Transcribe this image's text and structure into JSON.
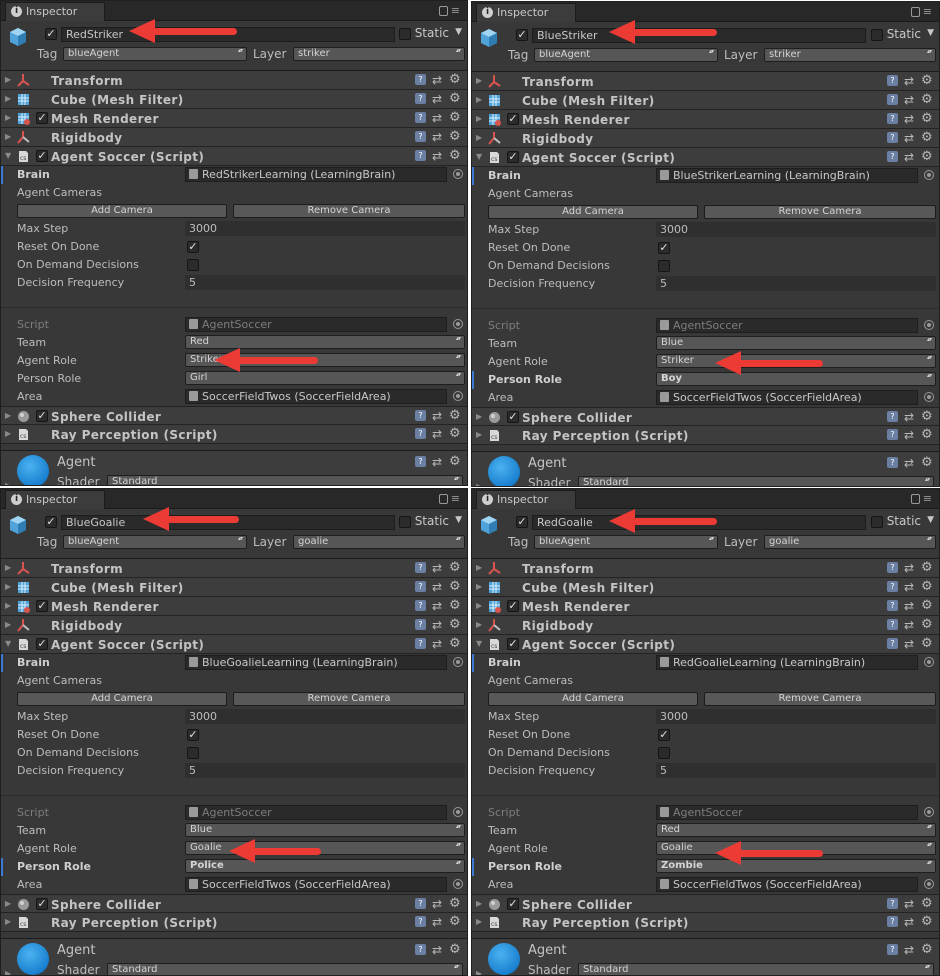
{
  "tab": {
    "label": "Inspector"
  },
  "header": {
    "tag_label": "Tag",
    "layer_label": "Layer",
    "static_label": "Static"
  },
  "components": {
    "transform": "Transform",
    "mesh_filter": "Cube (Mesh Filter)",
    "mesh_renderer": "Mesh Renderer",
    "rigidbody": "Rigidbody",
    "agent_soccer": "Agent Soccer (Script)",
    "sphere_collider": "Sphere Collider",
    "ray_perception": "Ray Perception (Script)"
  },
  "labels": {
    "brain": "Brain",
    "agent_cameras": "Agent Cameras",
    "add_camera": "Add Camera",
    "remove_camera": "Remove Camera",
    "max_step": "Max Step",
    "reset_on_done": "Reset On Done",
    "on_demand": "On Demand Decisions",
    "decision_frequency": "Decision Frequency",
    "script": "Script",
    "team": "Team",
    "agent_role": "Agent Role",
    "person_role": "Person Role",
    "area": "Area"
  },
  "material": {
    "name": "Agent",
    "shader_label": "Shader",
    "shader": "Standard"
  },
  "colors": {
    "arrow": "#ec3b35",
    "material_ball": "#1a80d0",
    "panel_bg": "#383838"
  },
  "panels": [
    {
      "name": "RedStriker",
      "tag": "blueAgent",
      "layer": "striker",
      "brain": "RedStrikerLearning (LearningBrain)",
      "max_step": "3000",
      "decision_frequency": "5",
      "script": "AgentSoccer",
      "team": "Red",
      "agent_role": "Striker",
      "person_role": "Girl",
      "area": "SoccerFieldTwos (SoccerFieldArea)"
    },
    {
      "name": "BlueStriker",
      "tag": "blueAgent",
      "layer": "striker",
      "brain": "BlueStrikerLearning (LearningBrain)",
      "max_step": "3000",
      "decision_frequency": "5",
      "script": "AgentSoccer",
      "team": "Blue",
      "agent_role": "Striker",
      "person_role": "Boy",
      "area": "SoccerFieldTwos (SoccerFieldArea)"
    },
    {
      "name": "BlueGoalie",
      "tag": "blueAgent",
      "layer": "goalie",
      "brain": "BlueGoalieLearning (LearningBrain)",
      "max_step": "3000",
      "decision_frequency": "5",
      "script": "AgentSoccer",
      "team": "Blue",
      "agent_role": "Goalie",
      "person_role": "Police",
      "area": "SoccerFieldTwos (SoccerFieldArea)"
    },
    {
      "name": "RedGoalie",
      "tag": "blueAgent",
      "layer": "goalie",
      "brain": "RedGoalieLearning (LearningBrain)",
      "max_step": "3000",
      "decision_frequency": "5",
      "script": "AgentSoccer",
      "team": "Red",
      "agent_role": "Goalie",
      "person_role": "Zombie",
      "area": "SoccerFieldTwos (SoccerFieldArea)"
    }
  ]
}
